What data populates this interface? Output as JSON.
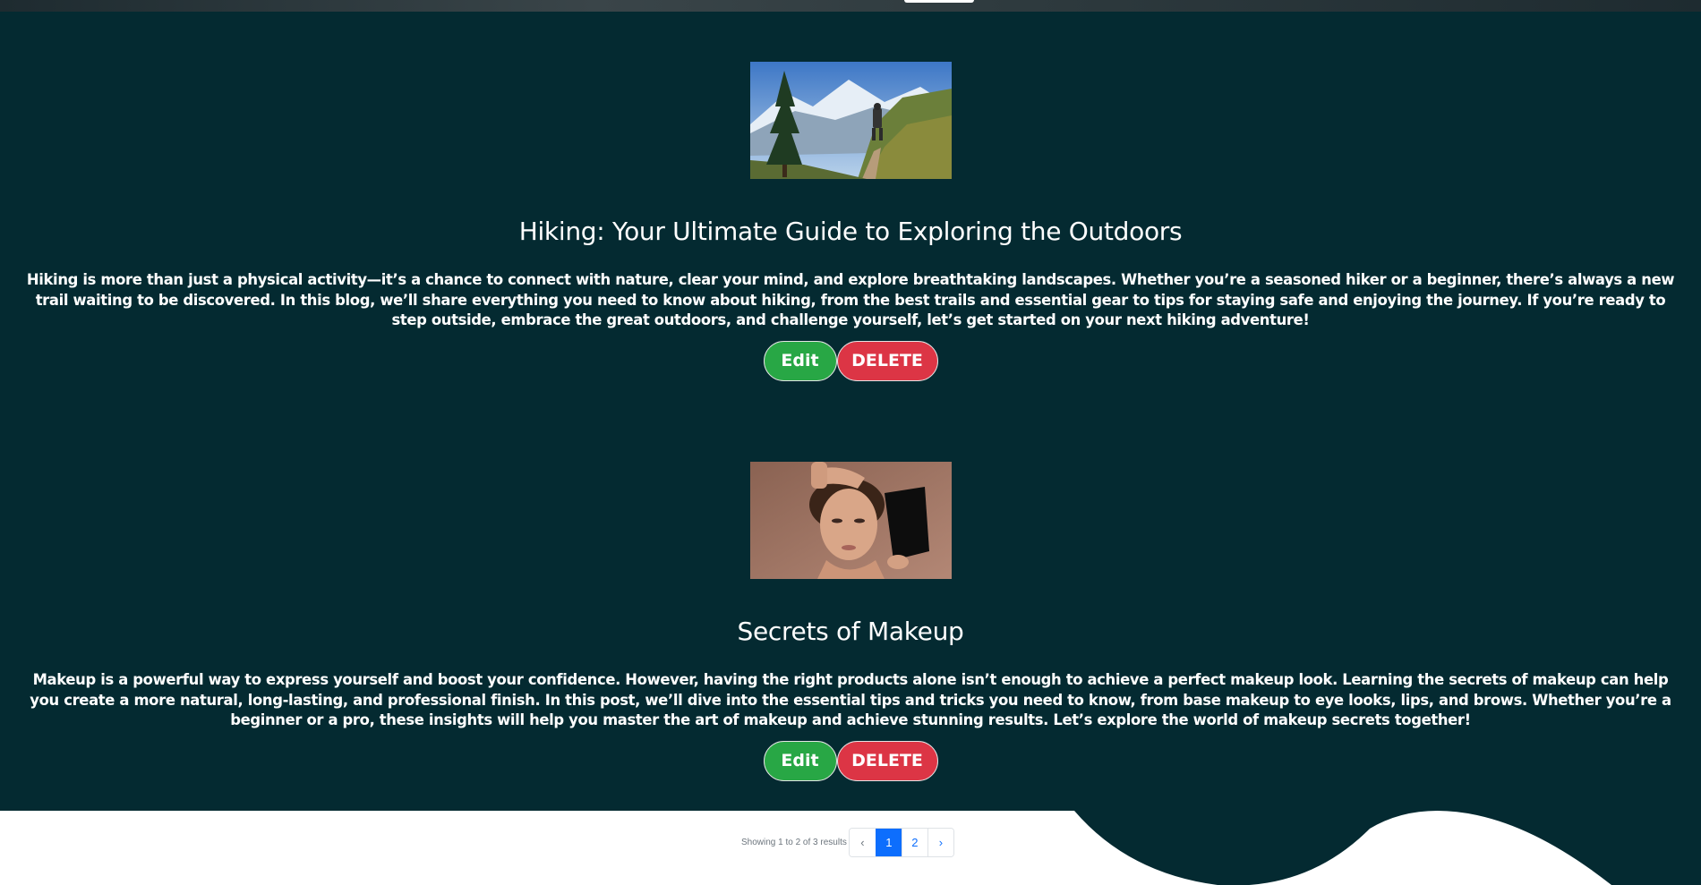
{
  "posts": [
    {
      "title": "Hiking: Your Ultimate Guide to Exploring the Outdoors",
      "body": "Hiking is more than just a physical activity—it’s a chance to connect with nature, clear your mind, and explore breathtaking landscapes. Whether you’re a seasoned hiker or a beginner, there’s always a new trail waiting to be discovered. In this blog, we’ll share everything you need to know about hiking, from the best trails and essential gear to tips for staying safe and enjoying the journey. If you’re ready to step outside, embrace the great outdoors, and challenge yourself, let’s get started on your next hiking adventure!",
      "edit_label": "Edit",
      "delete_label": "DELETE"
    },
    {
      "title": "Secrets of Makeup",
      "body": "Makeup is a powerful way to express yourself and boost your confidence. However, having the right products alone isn’t enough to achieve a perfect makeup look. Learning the secrets of makeup can help you create a more natural, long-lasting, and professional finish. In this post, we’ll dive into the essential tips and tricks you need to know, from base makeup to eye looks, lips, and brows. Whether you’re a beginner or a pro, these insights will help you master the art of makeup and achieve stunning results. Let’s explore the world of makeup secrets together!",
      "edit_label": "Edit",
      "delete_label": "DELETE"
    }
  ],
  "pagination": {
    "summary": "Showing 1 to 2 of 3 results",
    "prev": "‹",
    "pages": [
      "1",
      "2"
    ],
    "next": "›",
    "current_page": "1"
  },
  "colors": {
    "main_background": "#042a31",
    "edit_button": "#28a745",
    "delete_button": "#dc3545",
    "active_page": "#0d6efd"
  }
}
